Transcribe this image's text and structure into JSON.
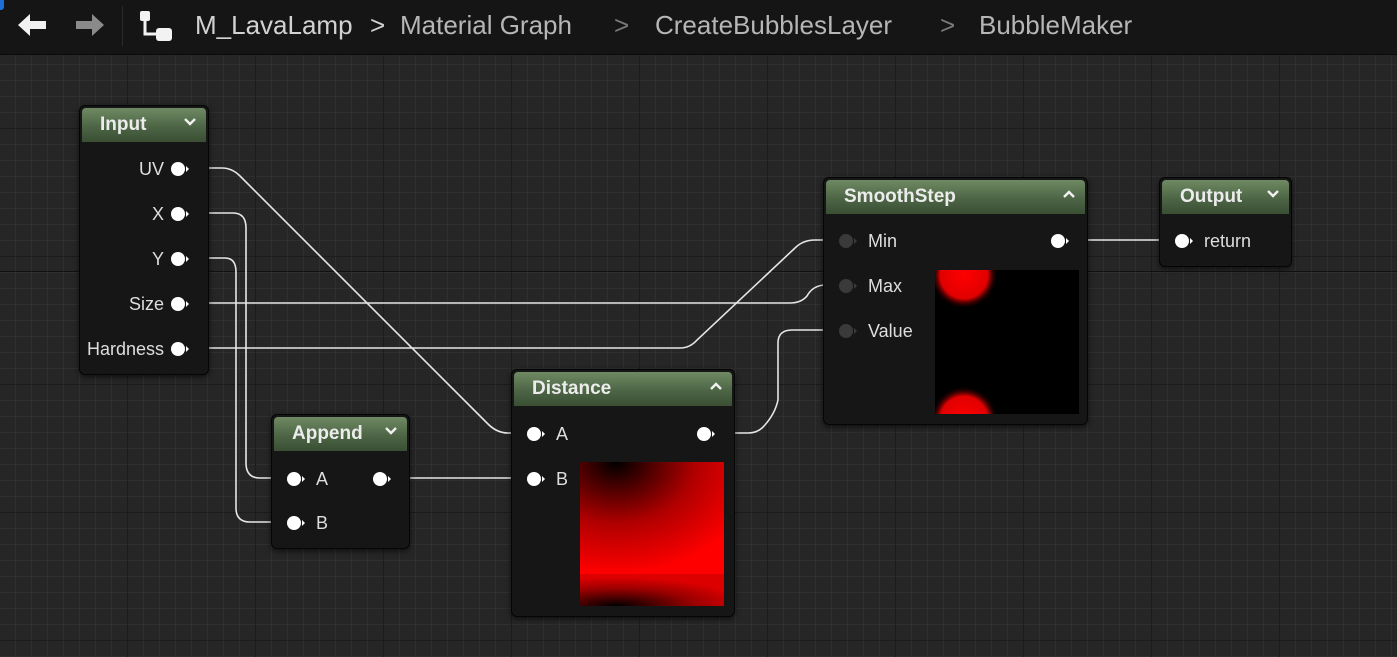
{
  "breadcrumb": {
    "items": [
      "M_LavaLamp",
      "Material Graph",
      "CreateBubblesLayer",
      "BubbleMaker"
    ],
    "separator": ">"
  },
  "nodes": {
    "input": {
      "title": "Input",
      "pins": {
        "uv": "UV",
        "x": "X",
        "y": "Y",
        "size": "Size",
        "hardness": "Hardness"
      }
    },
    "append": {
      "title": "Append",
      "pins": {
        "a": "A",
        "b": "B"
      }
    },
    "distance": {
      "title": "Distance",
      "pins": {
        "a": "A",
        "b": "B"
      }
    },
    "smoothstep": {
      "title": "SmoothStep",
      "pins": {
        "min": "Min",
        "max": "Max",
        "value": "Value"
      }
    },
    "output": {
      "title": "Output",
      "pins": {
        "return": "return"
      }
    }
  },
  "colors": {
    "header_green": "#4d6545",
    "pin_connected": "#ffffff",
    "pin_disconnected": "#3a3a3a",
    "wire": "#e6e6e6",
    "preview_red": "#ff0000"
  }
}
